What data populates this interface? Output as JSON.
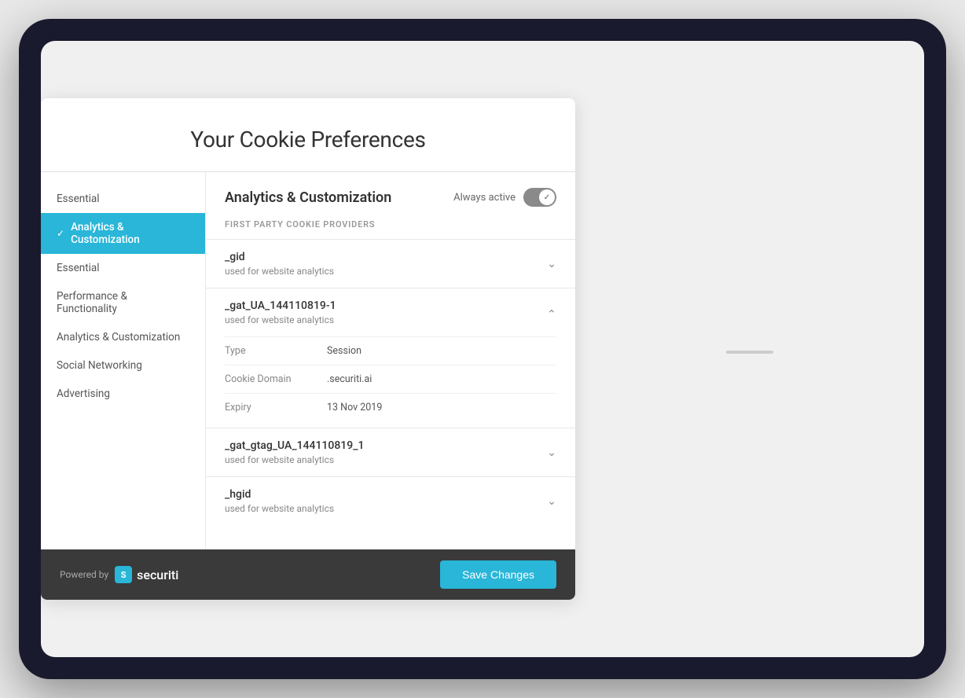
{
  "page": {
    "title": "Your Cookie Preferences",
    "background": "#e8e8e8"
  },
  "sidebar": {
    "items": [
      {
        "id": "essential-top",
        "label": "Essential",
        "active": false
      },
      {
        "id": "analytics-customization",
        "label": "Analytics & Customization",
        "active": true
      },
      {
        "id": "essential",
        "label": "Essential",
        "active": false
      },
      {
        "id": "performance-functionality",
        "label": "Performance & Functionality",
        "active": false
      },
      {
        "id": "analytics-customization2",
        "label": "Analytics & Customization",
        "active": false
      },
      {
        "id": "social-networking",
        "label": "Social Networking",
        "active": false
      },
      {
        "id": "advertising",
        "label": "Advertising",
        "active": false
      }
    ]
  },
  "content": {
    "title": "Analytics & Customization",
    "always_active_label": "Always active",
    "section_label": "FIRST PARTY COOKIE PROVIDERS",
    "cookies": [
      {
        "id": "gid",
        "name": "_gid",
        "description": "used for website analytics",
        "expanded": false,
        "details": []
      },
      {
        "id": "gat_ua",
        "name": "_gat_UA_144110819-1",
        "description": "used for website analytics",
        "expanded": true,
        "details": [
          {
            "label": "Type",
            "value": "Session"
          },
          {
            "label": "Cookie Domain",
            "value": ".securiti.ai"
          },
          {
            "label": "Expiry",
            "value": "13 Nov 2019"
          }
        ]
      },
      {
        "id": "gat_gtag",
        "name": "_gat_gtag_UA_144110819_1",
        "description": "used for website analytics",
        "expanded": false,
        "details": []
      },
      {
        "id": "hgid",
        "name": "_hgid",
        "description": "used for website analytics",
        "expanded": false,
        "details": []
      }
    ]
  },
  "footer": {
    "powered_by_label": "Powered by",
    "brand_name": "securiti",
    "save_button_label": "Save Changes"
  }
}
